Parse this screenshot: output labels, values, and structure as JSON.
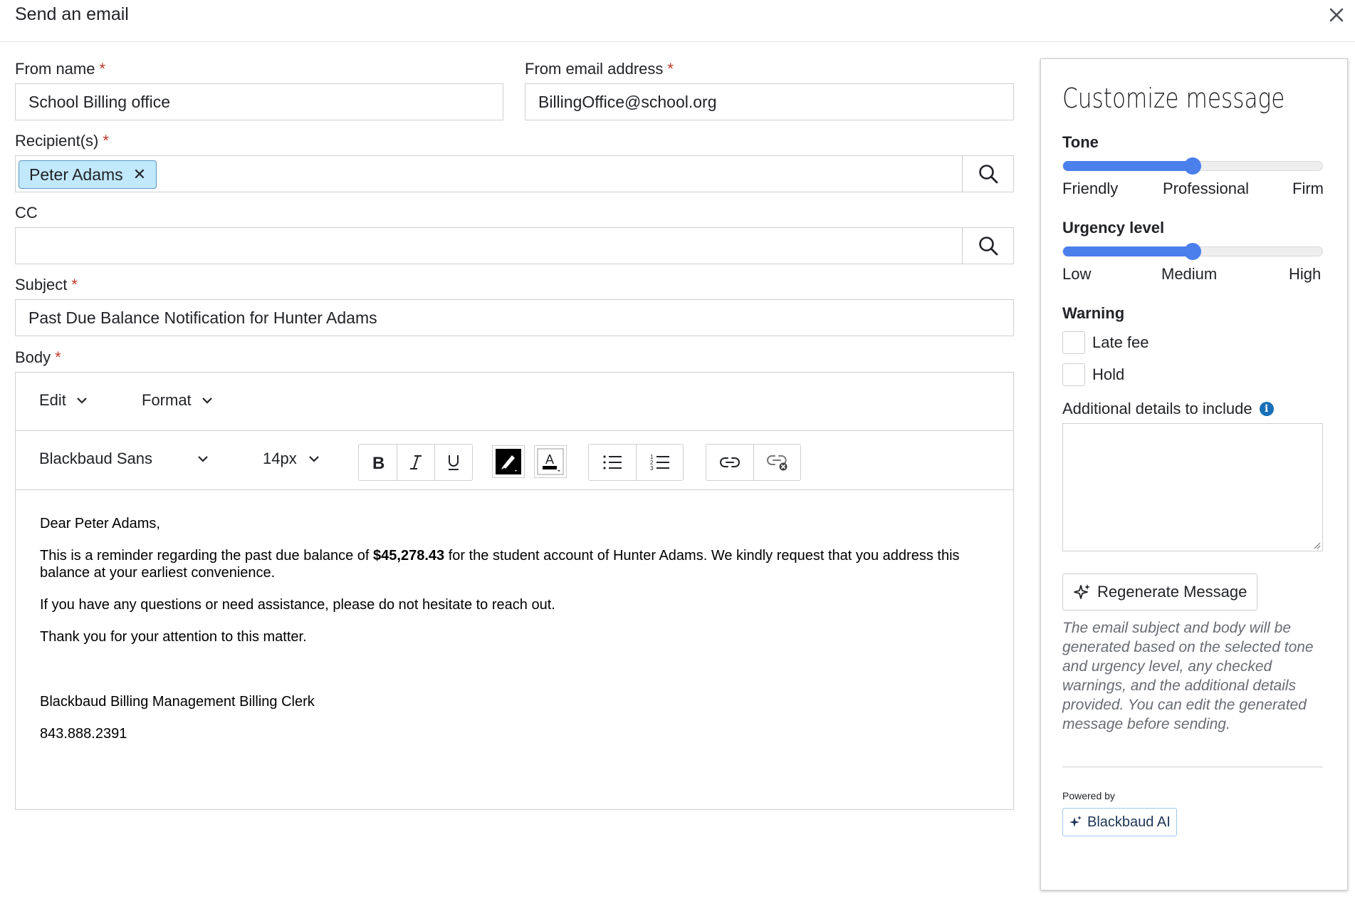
{
  "dialog": {
    "title": "Send an email"
  },
  "form": {
    "from_name": {
      "label": "From name",
      "value": "School Billing office"
    },
    "from_email": {
      "label": "From email address",
      "value": "BillingOffice@school.org"
    },
    "recipients": {
      "label": "Recipient(s)",
      "chips": [
        "Peter Adams"
      ]
    },
    "cc": {
      "label": "CC",
      "value": ""
    },
    "subject": {
      "label": "Subject",
      "value": "Past Due Balance Notification for Hunter Adams"
    },
    "body_label": "Body",
    "required_mark": "*"
  },
  "editor": {
    "menus": [
      "Edit",
      "Format"
    ],
    "font_family": "Blackbaud Sans",
    "font_size": "14px",
    "content": {
      "greeting": "Dear Peter Adams,",
      "p1_before": "This is a reminder regarding the past due balance of ",
      "p1_amount": "$45,278.43",
      "p1_after": " for the student account of Hunter Adams. We kindly request that you address this balance at your earliest convenience.",
      "p2": "If you have any questions or need assistance, please do not hesitate to reach out.",
      "p3": "Thank you for your attention to this matter.",
      "signature": "Blackbaud Billing Management Billing Clerk",
      "phone": "843.888.2391"
    }
  },
  "customize": {
    "title": "Customize message",
    "tone": {
      "label": "Tone",
      "ticks": [
        "Friendly",
        "Professional",
        "Firm"
      ],
      "value": 0.5
    },
    "urgency": {
      "label": "Urgency level",
      "ticks": [
        "Low",
        "Medium",
        "High"
      ],
      "value": 0.5
    },
    "warning": {
      "label": "Warning",
      "options": [
        {
          "label": "Late fee",
          "checked": false
        },
        {
          "label": "Hold",
          "checked": false
        }
      ]
    },
    "details_label": "Additional details to include",
    "details_value": "",
    "regenerate_label": "Regenerate Message",
    "note": "The email subject and body will be generated based on the selected tone and urgency level, any checked warnings, and the additional details provided. You can edit the generated message before sending.",
    "powered_by": "Powered by",
    "ai_label": "Blackbaud AI"
  },
  "colors": {
    "accent": "#4a7fec",
    "chip_bg": "#c1e8fb",
    "chip_border": "#5b96c5",
    "required": "#c0392b",
    "info": "#1870b8"
  },
  "icons": [
    "close-icon",
    "search-icon",
    "chevron-down-icon",
    "bold-icon",
    "italic-icon",
    "underline-icon",
    "highlight-color-icon",
    "text-color-icon",
    "bullet-list-icon",
    "numbered-list-icon",
    "link-icon",
    "unlink-icon",
    "info-icon",
    "sparkle-icon"
  ]
}
